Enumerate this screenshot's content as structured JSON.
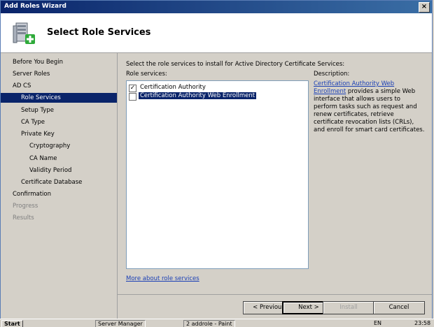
{
  "window": {
    "title": "Add Roles Wizard",
    "close_glyph": "×"
  },
  "header": {
    "title": "Select Role Services",
    "icon": "server-add-icon"
  },
  "nav": {
    "items": [
      "Before You Begin",
      "Server Roles",
      "AD CS",
      "Role Services",
      "Setup Type",
      "CA Type",
      "Private Key",
      "Cryptography",
      "CA Name",
      "Validity Period",
      "Certificate Database",
      "Confirmation",
      "Progress",
      "Results"
    ]
  },
  "content": {
    "instruction": "Select the role services to install for Active Directory Certificate Services:",
    "role_services_label": "Role services:",
    "services": [
      {
        "label": "Certification Authority",
        "checked": true
      },
      {
        "label": "Certification Authority Web Enrollment",
        "checked": false,
        "selected": true
      }
    ],
    "description_label": "Description:",
    "description_link": "Certification Authority Web Enrollment",
    "description_text": "provides a simple Web interface that allows users to perform tasks such as request and renew certificates, retrieve certificate revocation lists (CRLs), and enroll for smart card certificates.",
    "more_link": "More about role services"
  },
  "buttons": {
    "previous": "< Previous",
    "next": "Next >",
    "install": "Install",
    "cancel": "Cancel"
  },
  "taskbar": {
    "start": "Start",
    "server_manager": "Server Manager",
    "paint": "2 addrole - Paint",
    "lang": "EN",
    "time": "23:58"
  }
}
